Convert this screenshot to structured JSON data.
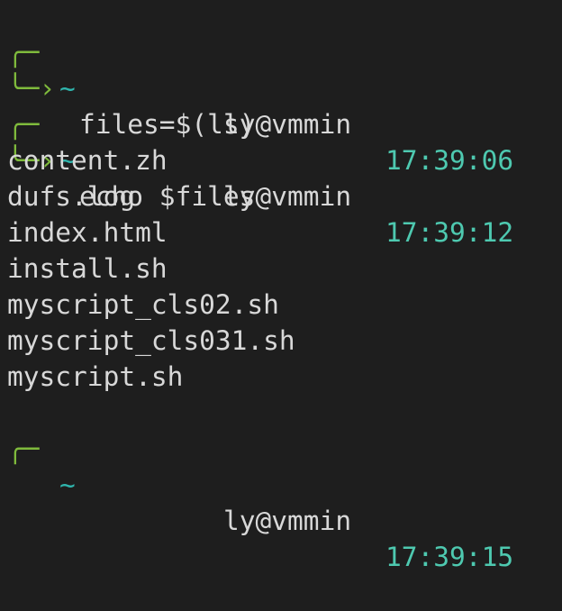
{
  "terminal": {
    "prompts": [
      {
        "corner_top": "╭─",
        "tilde": "~",
        "user_host": "ly@vmmin",
        "time": "17:39:06",
        "corner_bottom": "╰─›",
        "command": "files=$(ls)"
      },
      {
        "corner_top": "╭─",
        "tilde": "~",
        "user_host": "ly@vmmin",
        "time": "17:39:12",
        "corner_bottom": "╰─›",
        "command": "echo $files"
      }
    ],
    "output_lines": [
      "content.zh",
      "dufs.log",
      "index.html",
      "install.sh",
      "myscript_cls02.sh",
      "myscript_cls031.sh",
      "myscript.sh"
    ],
    "partial_prompt": {
      "corner_top": "╭─",
      "tilde": "~",
      "user_host": "ly@vmmin",
      "time": "17:39:15"
    }
  },
  "colors": {
    "background": "#1e1e1e",
    "foreground": "#d8d8d8",
    "prompt_green": "#7fba3c",
    "time_cyan": "#4ec9b0"
  }
}
